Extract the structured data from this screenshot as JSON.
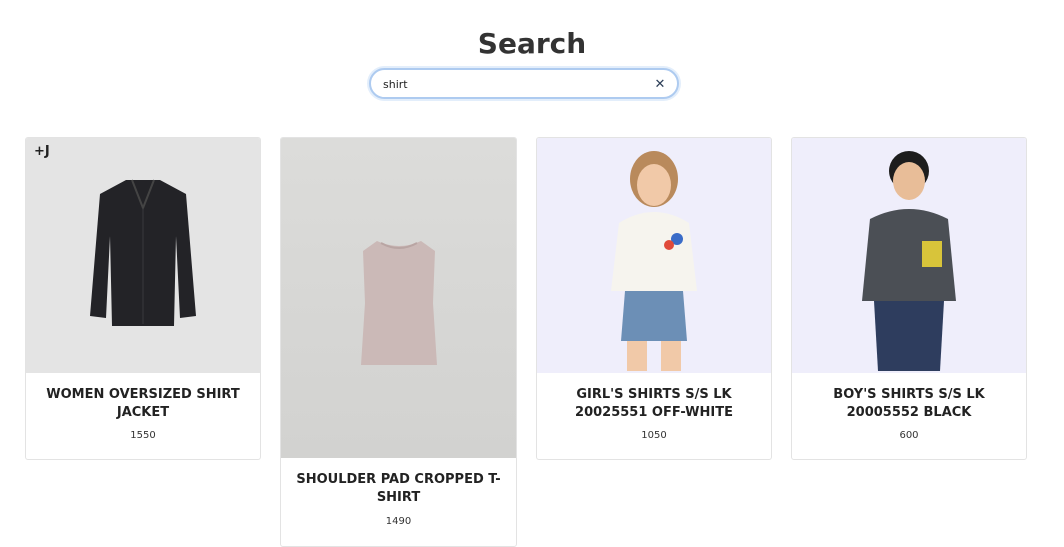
{
  "page": {
    "title": "Search"
  },
  "search": {
    "value": "shirt",
    "clear_icon": "close-icon"
  },
  "products": [
    {
      "name": "WOMEN OVERSIZED SHIRT JACKET",
      "price": "1550",
      "badge": "+J",
      "image_bg": "#e4e4e4"
    },
    {
      "name": "SHOULDER PAD CROPPED T-SHIRT",
      "price": "1490",
      "image_bg": "#d8d8d6"
    },
    {
      "name": "GIRL'S SHIRTS S/S LK 20025551 OFF-WHITE",
      "price": "1050",
      "image_bg": "#efeefb"
    },
    {
      "name": "BOY'S SHIRTS S/S LK 20005552 BLACK",
      "price": "600",
      "image_bg": "#efeefb"
    }
  ]
}
